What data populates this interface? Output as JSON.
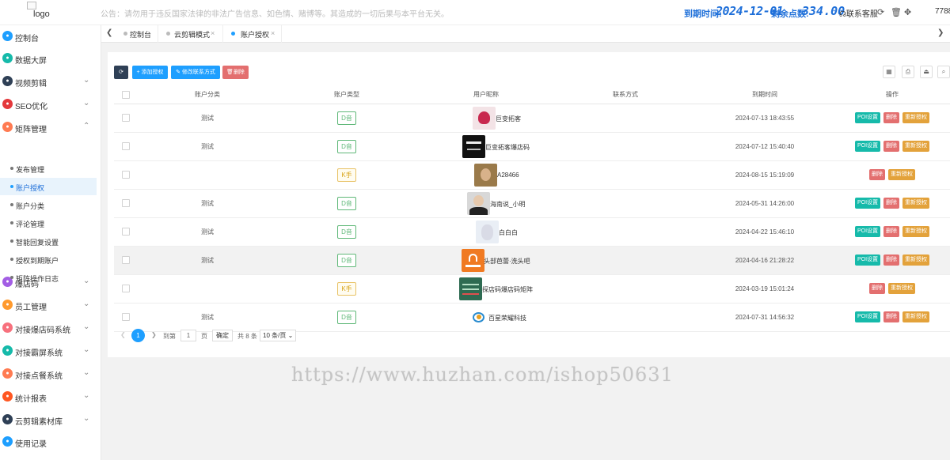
{
  "header": {
    "logo_text": "logo",
    "notice": "公告：请勿用于违反国家法律的非法广告信息、如色情、赌博等。其造成的一切后果与本平台无关。",
    "expire_label": "到期时间:",
    "expire_value": "2024-12-01",
    "points_label": "剩余点数:",
    "points_value": "334.00",
    "service_label": "联系客服",
    "user_text": "7788"
  },
  "sidebar": {
    "items": [
      {
        "label": "控制台",
        "icon": "monitor-icon",
        "color": "#1e9fff"
      },
      {
        "label": "数据大屏",
        "icon": "screen-icon",
        "color": "#16baaa"
      },
      {
        "label": "视频剪辑",
        "icon": "video-icon",
        "color": "#2f4056"
      },
      {
        "label": "SEO优化",
        "icon": "seo-icon",
        "color": "#e4393c"
      },
      {
        "label": "矩阵管理",
        "icon": "matrix-icon",
        "color": "#ff7b52"
      },
      {
        "label": "爆店码",
        "icon": "qrcode-icon",
        "color": "#a35ee4"
      },
      {
        "label": "员工管理",
        "icon": "staff-icon",
        "color": "#ff9a2e"
      },
      {
        "label": "对接爆店码系统",
        "icon": "link-icon",
        "color": "#f7717d"
      },
      {
        "label": "对接霸屏系统",
        "icon": "link-icon",
        "color": "#16baaa"
      },
      {
        "label": "对接点餐系统",
        "icon": "food-icon",
        "color": "#ff7b52"
      },
      {
        "label": "统计报表",
        "icon": "chart-icon",
        "color": "#ff5722"
      },
      {
        "label": "云剪辑素材库",
        "icon": "cloud-icon",
        "color": "#2f4056"
      },
      {
        "label": "使用记录",
        "icon": "record-icon",
        "color": "#1e9fff"
      }
    ],
    "sub_items": [
      "发布管理",
      "账户授权",
      "账户分类",
      "评论管理",
      "智能回复设置",
      "授权到期账户",
      "矩阵操作日志"
    ]
  },
  "tabs": [
    {
      "label": "控制台"
    },
    {
      "label": "云剪辑模式"
    },
    {
      "label": "账户授权"
    }
  ],
  "toolbar": {
    "refresh_icon": "refresh-icon",
    "add_label": "添加授权",
    "edit_label": "修改联系方式",
    "delete_label": "删除",
    "add_color": "#1e9fff",
    "delete_color": "#e36f6f"
  },
  "table": {
    "columns": [
      "账户分类",
      "账户类型",
      "用户昵称",
      "联系方式",
      "到期时间",
      "操作"
    ],
    "rows": [
      {
        "category": "测试",
        "type": "D音",
        "nickname": "巨变拓客",
        "contact": "",
        "expire": "2024-07-13 18:43:55",
        "ops": [
          "POI设置",
          "删除",
          "重新授权"
        ]
      },
      {
        "category": "测试",
        "type": "D音",
        "nickname": "巨变拓客爆店码",
        "contact": "",
        "expire": "2024-07-12 15:40:40",
        "ops": [
          "POI设置",
          "删除",
          "重新授权"
        ]
      },
      {
        "category": "",
        "type": "K手",
        "nickname": "A28466",
        "contact": "",
        "expire": "2024-08-15 15:19:09",
        "ops": [
          "删除",
          "重新授权"
        ]
      },
      {
        "category": "测试",
        "type": "D音",
        "nickname": "海南说_小明",
        "contact": "",
        "expire": "2024-05-31 14:26:00",
        "ops": [
          "POI设置",
          "删除",
          "重新授权"
        ]
      },
      {
        "category": "测试",
        "type": "D音",
        "nickname": "白白白",
        "contact": "",
        "expire": "2024-04-22 15:46:10",
        "ops": [
          "POI设置",
          "删除",
          "重新授权"
        ]
      },
      {
        "category": "测试",
        "type": "D音",
        "nickname": "头部芭蕾·洗头吧",
        "contact": "",
        "expire": "2024-04-16 21:28:22",
        "ops": [
          "POI设置",
          "删除",
          "重新授权"
        ]
      },
      {
        "category": "",
        "type": "K手",
        "nickname": "探店码爆店码矩阵",
        "contact": "",
        "expire": "2024-03-19 15:01:24",
        "ops": [
          "删除",
          "重新授权"
        ]
      },
      {
        "category": "测试",
        "type": "D音",
        "nickname": "百星荣耀科技",
        "contact": "",
        "expire": "2024-07-31 14:56:32",
        "ops": [
          "POI设置",
          "删除",
          "重新授权"
        ]
      }
    ]
  },
  "pager": {
    "current": "1",
    "goto_label": "到第",
    "page_input": "1",
    "page_unit": "页",
    "confirm_label": "确定",
    "total": "共 8 条",
    "page_size": "10 条/页"
  },
  "watermark": "https://www.huzhan.com/ishop50631"
}
